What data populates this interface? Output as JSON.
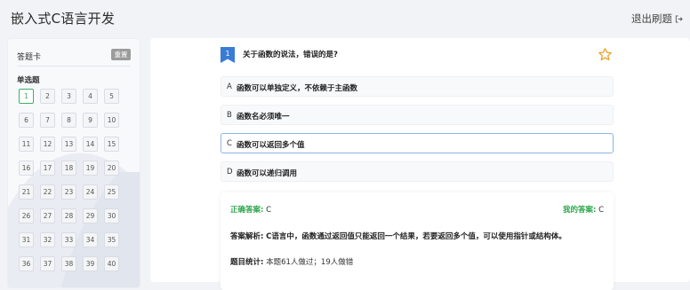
{
  "header": {
    "title": "嵌入式C语言开发",
    "exit_label": "退出刷题"
  },
  "answer_card": {
    "title": "答题卡",
    "reset_label": "重置",
    "section_label": "单选题",
    "numbers": [
      "1",
      "2",
      "3",
      "4",
      "5",
      "6",
      "7",
      "8",
      "9",
      "10",
      "11",
      "12",
      "13",
      "14",
      "15",
      "16",
      "17",
      "18",
      "19",
      "20",
      "21",
      "22",
      "23",
      "24",
      "25",
      "26",
      "27",
      "28",
      "29",
      "30",
      "31",
      "32",
      "33",
      "34",
      "35",
      "36",
      "37",
      "38",
      "39",
      "40"
    ],
    "active_index": 0
  },
  "question": {
    "number": "1",
    "text": "关于函数的说法，错误的是?",
    "options": [
      {
        "letter": "A",
        "text": "函数可以单独定义，不依赖于主函数"
      },
      {
        "letter": "B",
        "text": "函数名必须唯一"
      },
      {
        "letter": "C",
        "text": "函数可以返回多个值"
      },
      {
        "letter": "D",
        "text": "函数可以递归调用"
      }
    ],
    "selected_option": "C"
  },
  "analysis": {
    "correct_label": "正确答案:",
    "correct_value": "C",
    "my_label": "我的答案:",
    "my_value": "C",
    "explain_label": "答案解析:",
    "explain_text": "C语言中，函数通过返回值只能返回一个结果，若要返回多个值，可以使用指针或结构体。",
    "stats_label": "题目统计:",
    "stats_text": "本题61人做过；19人做错"
  },
  "colors": {
    "accent_blue": "#3a7bd5",
    "correct_green": "#2fa64e",
    "star_orange": "#f0a020"
  }
}
